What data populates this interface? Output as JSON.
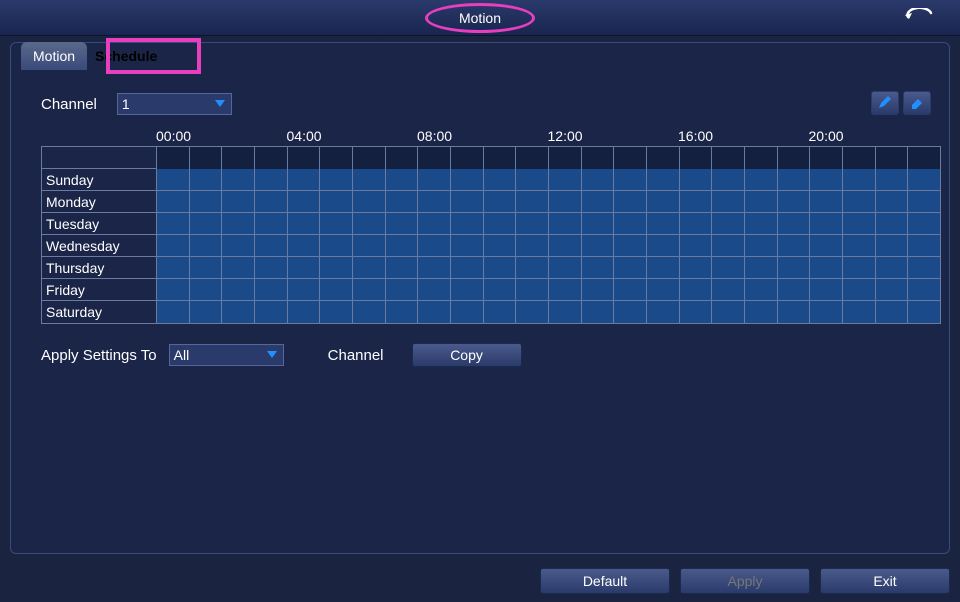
{
  "title": "Motion",
  "tabs": {
    "motion": "Motion",
    "schedule": "Schedule"
  },
  "channel": {
    "label": "Channel",
    "value": "1"
  },
  "timeLabels": [
    "00:00",
    "04:00",
    "08:00",
    "12:00",
    "16:00",
    "20:00"
  ],
  "days": [
    "Sunday",
    "Monday",
    "Tuesday",
    "Wednesday",
    "Thursday",
    "Friday",
    "Saturday"
  ],
  "applySettings": {
    "label": "Apply Settings To",
    "value": "All",
    "channelLabel": "Channel",
    "copy": "Copy"
  },
  "footer": {
    "default": "Default",
    "apply": "Apply",
    "exit": "Exit"
  },
  "icons": {
    "edit": "edit-icon",
    "erase": "erase-icon",
    "back": "back-icon",
    "arrow": "dropdown-arrow"
  },
  "colors": {
    "highlight": "#e83ec0",
    "cellFill": "#1a4a8a"
  }
}
